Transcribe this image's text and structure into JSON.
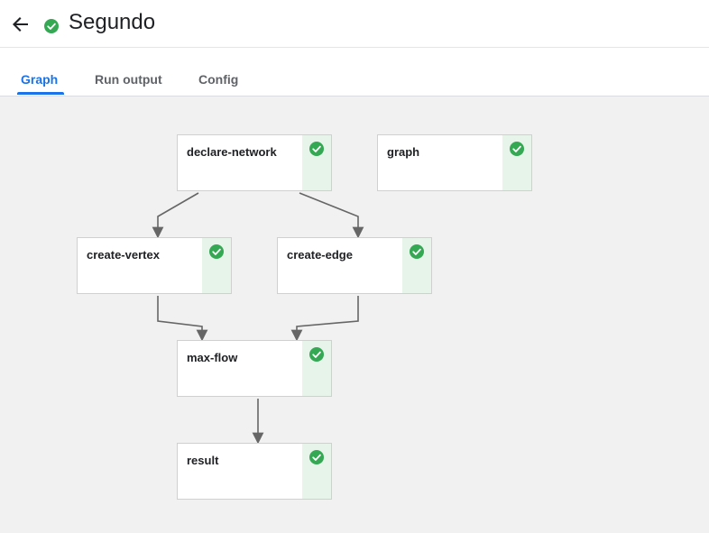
{
  "header": {
    "back_icon": "arrow-back-icon",
    "status_icon": "check-circle-icon",
    "status_color": "#34a853",
    "title": "Segundo"
  },
  "tabs": [
    {
      "label": "Graph",
      "active": true
    },
    {
      "label": "Run output",
      "active": false
    },
    {
      "label": "Config",
      "active": false
    }
  ],
  "graph": {
    "nodes": [
      {
        "id": "declare-network",
        "label": "declare-network",
        "status": "succeeded"
      },
      {
        "id": "graph",
        "label": "graph",
        "status": "succeeded"
      },
      {
        "id": "create-vertex",
        "label": "create-vertex",
        "status": "succeeded"
      },
      {
        "id": "create-edge",
        "label": "create-edge",
        "status": "succeeded"
      },
      {
        "id": "max-flow",
        "label": "max-flow",
        "status": "succeeded"
      },
      {
        "id": "result",
        "label": "result",
        "status": "succeeded"
      }
    ],
    "edges": [
      {
        "from": "declare-network",
        "to": "create-vertex"
      },
      {
        "from": "declare-network",
        "to": "create-edge"
      },
      {
        "from": "create-vertex",
        "to": "max-flow"
      },
      {
        "from": "create-edge",
        "to": "max-flow"
      },
      {
        "from": "max-flow",
        "to": "result"
      }
    ],
    "success_color": "#34a853",
    "status_bg_color": "#e6f4ea"
  }
}
